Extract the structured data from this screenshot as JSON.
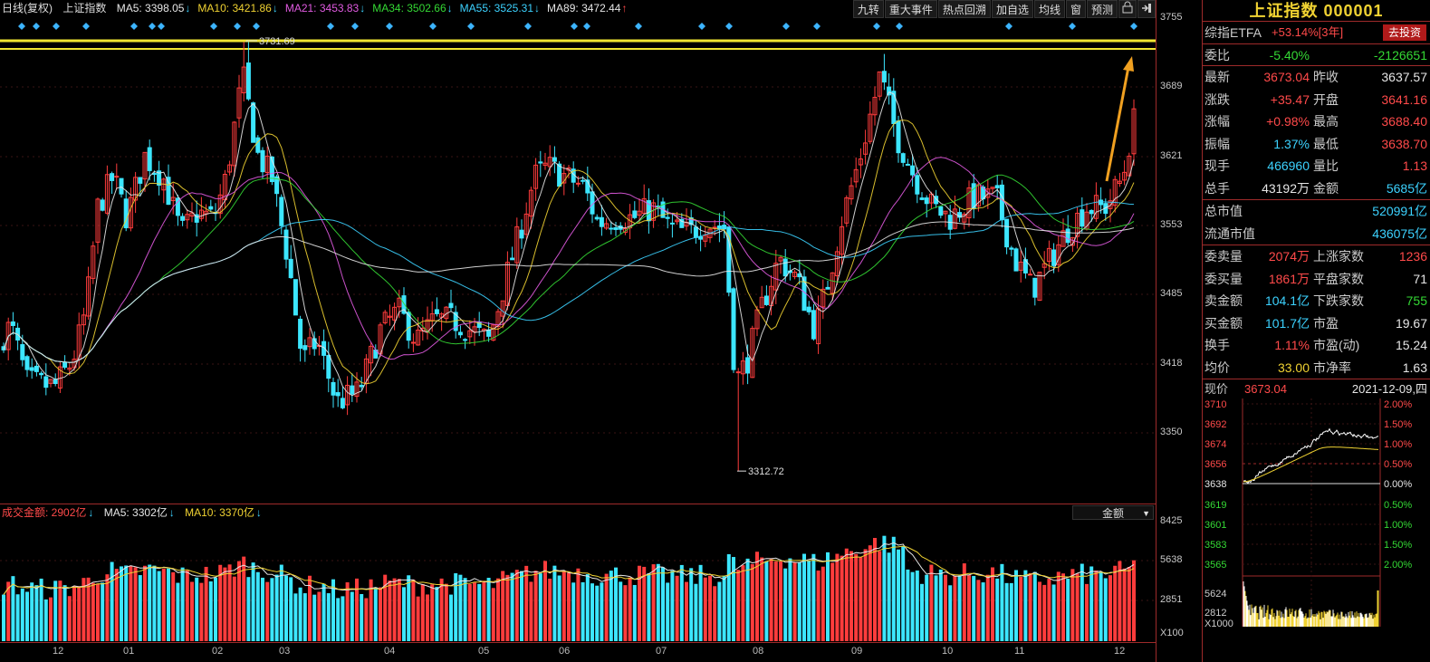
{
  "header": {
    "chart_label": "日线(复权)",
    "index_name": "上证指数",
    "ma": [
      {
        "label": "MA5: 3398.05",
        "arrow": "↓",
        "color": "#e6e6e6"
      },
      {
        "label": "MA10: 3421.86",
        "arrow": "↓",
        "color": "#f0d232"
      },
      {
        "label": "MA21: 3453.83",
        "arrow": "↓",
        "color": "#e05ae0"
      },
      {
        "label": "MA34: 3502.66",
        "arrow": "↓",
        "color": "#34d834"
      },
      {
        "label": "MA55: 3525.31",
        "arrow": "↓",
        "color": "#3cd2ff"
      },
      {
        "label": "MA89: 3472.44",
        "arrow": "↑",
        "color": "#e6e6e6"
      }
    ]
  },
  "toolbar": [
    "九转",
    "重大事件",
    "热点回溯",
    "加自选",
    "均线",
    "窗",
    "预测"
  ],
  "price_axis": [
    "3755",
    "3689",
    "3621",
    "3553",
    "3485",
    "3418",
    "3350"
  ],
  "annotations": {
    "high": "3731.69",
    "low": "3312.72"
  },
  "volume_header": {
    "label": "成交金额: 2902亿",
    "ma5": "MA5: 3302亿",
    "ma10": "MA10: 3370亿",
    "dropdown": "金额"
  },
  "volume_axis": [
    "8425",
    "5638",
    "2851",
    "X100"
  ],
  "months": [
    "12",
    "01",
    "02",
    "03",
    "04",
    "05",
    "06",
    "07",
    "08",
    "09",
    "10",
    "11",
    "12"
  ],
  "info": {
    "title": "上证指数 000001",
    "etf_label": "综指ETFA",
    "etf_value": "+53.14%[3年]",
    "invest_button": "去投资",
    "weibi_label": "委比",
    "weibi_value": "-5.40%",
    "weicha_value": "-2126651",
    "quote_rows": [
      {
        "l1": "最新",
        "v1": "3673.04",
        "c1": "red",
        "l2": "昨收",
        "v2": "3637.57",
        "c2": "white"
      },
      {
        "l1": "涨跌",
        "v1": "+35.47",
        "c1": "red",
        "l2": "开盘",
        "v2": "3641.16",
        "c2": "red"
      },
      {
        "l1": "涨幅",
        "v1": "+0.98%",
        "c1": "red",
        "l2": "最高",
        "v2": "3688.40",
        "c2": "red"
      },
      {
        "l1": "振幅",
        "v1": "1.37%",
        "c1": "cyan",
        "l2": "最低",
        "v2": "3638.70",
        "c2": "red"
      },
      {
        "l1": "现手",
        "v1": "466960",
        "c1": "cyan",
        "l2": "量比",
        "v2": "1.13",
        "c2": "red"
      },
      {
        "l1": "总手",
        "v1": "43192万",
        "c1": "white",
        "l2": "金额",
        "v2": "5685亿",
        "c2": "cyan"
      }
    ],
    "cap_rows": [
      {
        "l": "总市值",
        "v": "520991亿"
      },
      {
        "l": "流通市值",
        "v": "436075亿"
      }
    ],
    "stat_rows": [
      {
        "l1": "委卖量",
        "v1": "2074万",
        "c1": "red",
        "l2": "上涨家数",
        "v2": "1236",
        "c2": "red"
      },
      {
        "l1": "委买量",
        "v1": "1861万",
        "c1": "red",
        "l2": "平盘家数",
        "v2": "71",
        "c2": "white"
      },
      {
        "l1": "卖金额",
        "v1": "104.1亿",
        "c1": "cyan",
        "l2": "下跌家数",
        "v2": "755",
        "c2": "green"
      },
      {
        "l1": "买金额",
        "v1": "101.7亿",
        "c1": "cyan",
        "l2": "市盈",
        "v2": "19.67",
        "c2": "white"
      },
      {
        "l1": "换手",
        "v1": "1.11%",
        "c1": "red",
        "l2": "市盈(动)",
        "v2": "15.24",
        "c2": "white"
      },
      {
        "l1": "均价",
        "v1": "33.00",
        "c1": "yellow",
        "l2": "市净率",
        "v2": "1.63",
        "c2": "white"
      }
    ],
    "mini_header": {
      "label": "现价",
      "price": "3673.04",
      "date": "2021-12-09,四"
    },
    "mini_left_axis": [
      "3710",
      "3692",
      "3674",
      "3656",
      "3638",
      "3619",
      "3601",
      "3583",
      "3565",
      "5624",
      "2812",
      "X1000"
    ],
    "mini_right_axis": [
      "2.00%",
      "1.50%",
      "1.00%",
      "0.50%",
      "0.00%",
      "0.50%",
      "1.00%",
      "1.50%",
      "2.00%"
    ]
  },
  "colors": {
    "up": "#ff3c3c",
    "down": "#3ce6ff",
    "border": "#9e2a2a",
    "resistance": "#f0e632"
  },
  "icons": [
    "lock-icon",
    "exit-icon",
    "up-arrow-annotation"
  ]
}
